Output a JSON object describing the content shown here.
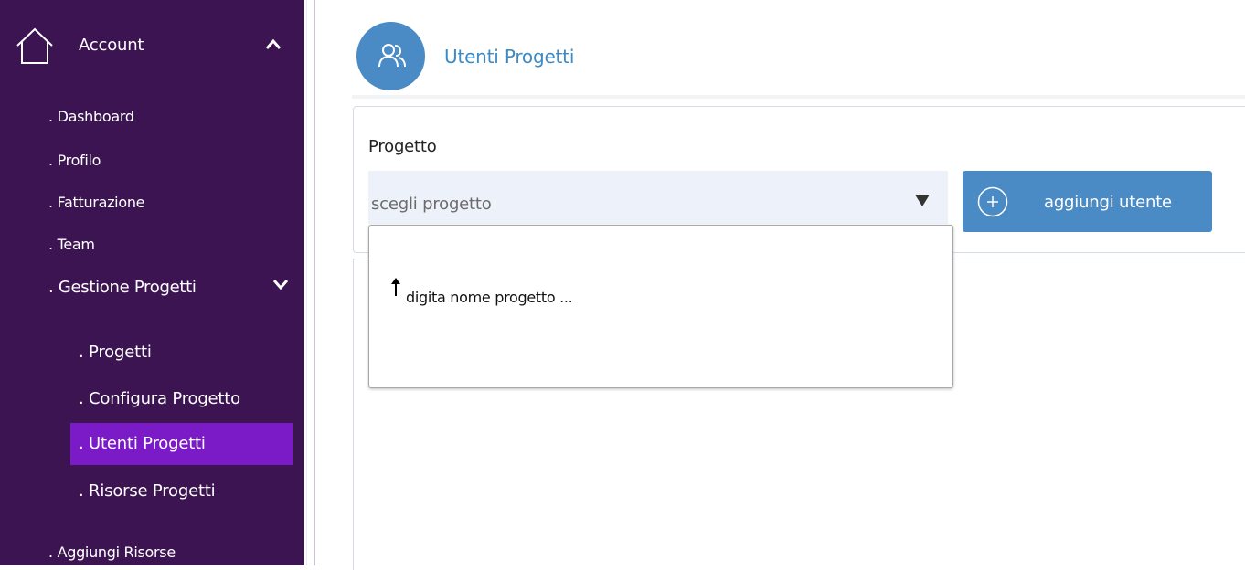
{
  "sidebar": {
    "account_label": "Account",
    "items": [
      {
        "label": ". Dashboard"
      },
      {
        "label": ". Profilo"
      },
      {
        "label": ". Fatturazione"
      },
      {
        "label": ". Team"
      },
      {
        "label": ". Gestione Progetti"
      }
    ],
    "sub_items": [
      {
        "label": ". Progetti"
      },
      {
        "label": ". Configura Progetto"
      },
      {
        "label": ". Utenti Progetti",
        "active": true
      },
      {
        "label": ". Risorse Progetti"
      }
    ],
    "bottom_item": {
      "label": ". Aggiungi Risorse"
    },
    "colors": {
      "background": "#3c1451",
      "active": "#7b1bc8"
    }
  },
  "header": {
    "title": "Utenti Progetti",
    "icon": "users-icon",
    "accent": "#4a8bc6"
  },
  "form": {
    "project_label": "Progetto",
    "project_select": {
      "value": "scegli progetto"
    },
    "add_button_label": "aggiungi utente",
    "dropdown_hint": "digita nome progetto ..."
  }
}
